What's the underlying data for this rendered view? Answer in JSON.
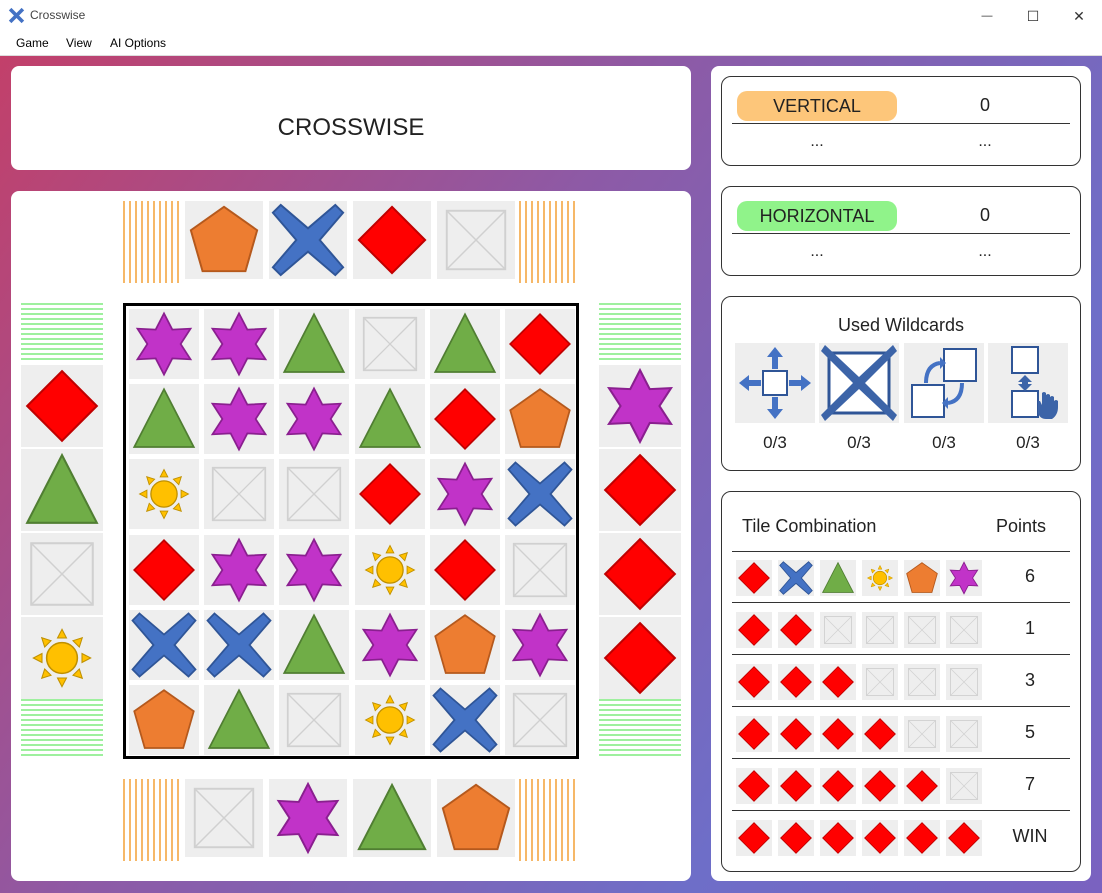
{
  "window": {
    "title": "Crosswise",
    "min": "—",
    "max": "☐",
    "close": "✕"
  },
  "menu": [
    "Game",
    "View",
    "AI Options"
  ],
  "game_title": "CROSSWISE",
  "colors": {
    "diamond": "#ff0000",
    "pentagon": "#ed7d31",
    "cross": "#4472c4",
    "triangle": "#70ad47",
    "star": "#c133c8",
    "sun": "#ffc000",
    "vertical": "#fdc67a",
    "horizontal": "#90f38a"
  },
  "hand_top": [
    "pentagon",
    "cross",
    "diamond",
    "empty"
  ],
  "hand_bottom": [
    "empty",
    "star",
    "triangle",
    "pentagon"
  ],
  "hand_left": [
    "diamond",
    "triangle",
    "empty",
    "sun"
  ],
  "hand_right": [
    "star",
    "diamond",
    "diamond",
    "diamond"
  ],
  "board": [
    [
      "star",
      "star",
      "triangle",
      "empty",
      "triangle",
      "diamond"
    ],
    [
      "triangle",
      "star",
      "star",
      "triangle",
      "diamond",
      "pentagon"
    ],
    [
      "sun",
      "empty",
      "empty",
      "diamond",
      "star",
      "cross"
    ],
    [
      "diamond",
      "star",
      "star",
      "sun",
      "diamond",
      "empty"
    ],
    [
      "cross",
      "cross",
      "triangle",
      "star",
      "pentagon",
      "star"
    ],
    [
      "pentagon",
      "triangle",
      "empty",
      "sun",
      "cross",
      "empty"
    ]
  ],
  "players": [
    {
      "label": "VERTICAL",
      "score": "0",
      "dots_left": "...",
      "dots_right": "..."
    },
    {
      "label": "HORIZONTAL",
      "score": "0",
      "dots_left": "...",
      "dots_right": "..."
    }
  ],
  "wildcards": {
    "title": "Used Wildcards",
    "items": [
      {
        "icon": "move-icon",
        "count": "0/3"
      },
      {
        "icon": "remove-icon",
        "count": "0/3"
      },
      {
        "icon": "swap-icon",
        "count": "0/3"
      },
      {
        "icon": "replace-icon",
        "count": "0/3"
      }
    ]
  },
  "combos": {
    "header_tiles": "Tile Combination",
    "header_points": "Points",
    "rows": [
      {
        "tiles": [
          "diamond",
          "cross",
          "triangle",
          "sun",
          "pentagon",
          "star"
        ],
        "points": "6"
      },
      {
        "tiles": [
          "diamond",
          "diamond",
          "empty",
          "empty",
          "empty",
          "empty"
        ],
        "points": "1"
      },
      {
        "tiles": [
          "diamond",
          "diamond",
          "diamond",
          "empty",
          "empty",
          "empty"
        ],
        "points": "3"
      },
      {
        "tiles": [
          "diamond",
          "diamond",
          "diamond",
          "diamond",
          "empty",
          "empty"
        ],
        "points": "5"
      },
      {
        "tiles": [
          "diamond",
          "diamond",
          "diamond",
          "diamond",
          "diamond",
          "empty"
        ],
        "points": "7"
      },
      {
        "tiles": [
          "diamond",
          "diamond",
          "diamond",
          "diamond",
          "diamond",
          "diamond"
        ],
        "points": "WIN"
      }
    ]
  }
}
